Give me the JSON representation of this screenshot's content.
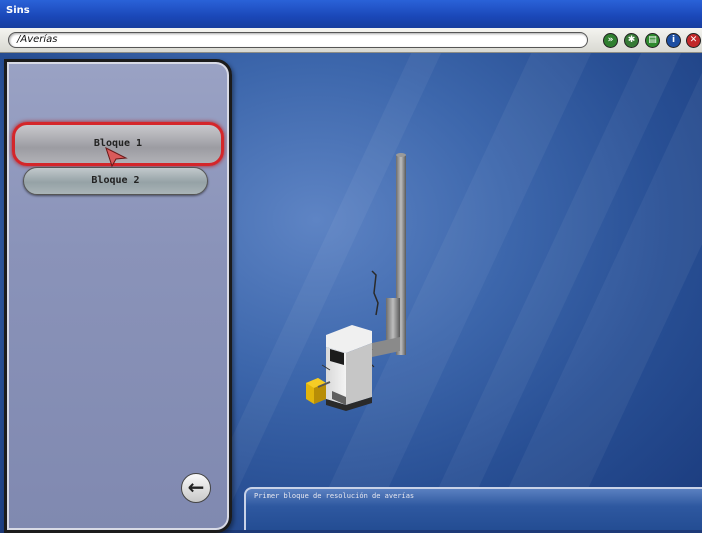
{
  "window": {
    "title": "Sins"
  },
  "toolbar": {
    "path": "/Averías",
    "buttons": [
      {
        "name": "forward-icon",
        "glyph": "»",
        "color": "#2f7f2f"
      },
      {
        "name": "settings-icon",
        "glyph": "✱",
        "color": "#367a36"
      },
      {
        "name": "print-icon",
        "glyph": "▤",
        "color": "#2e8a2e"
      },
      {
        "name": "info-icon",
        "glyph": "i",
        "color": "#1d4fa2"
      },
      {
        "name": "close-icon",
        "glyph": "✕",
        "color": "#c2282a"
      }
    ]
  },
  "sidebar": {
    "items": [
      {
        "label": "Bloque 1",
        "selected": true
      },
      {
        "label": "Bloque 2",
        "selected": false
      }
    ],
    "back_icon": "back-arrow-icon"
  },
  "description": {
    "text": "Primer bloque de resolución de averías"
  },
  "colors": {
    "titlebar": "#1a47b8",
    "background": "#2b559c",
    "selected_border": "#d4262a"
  }
}
